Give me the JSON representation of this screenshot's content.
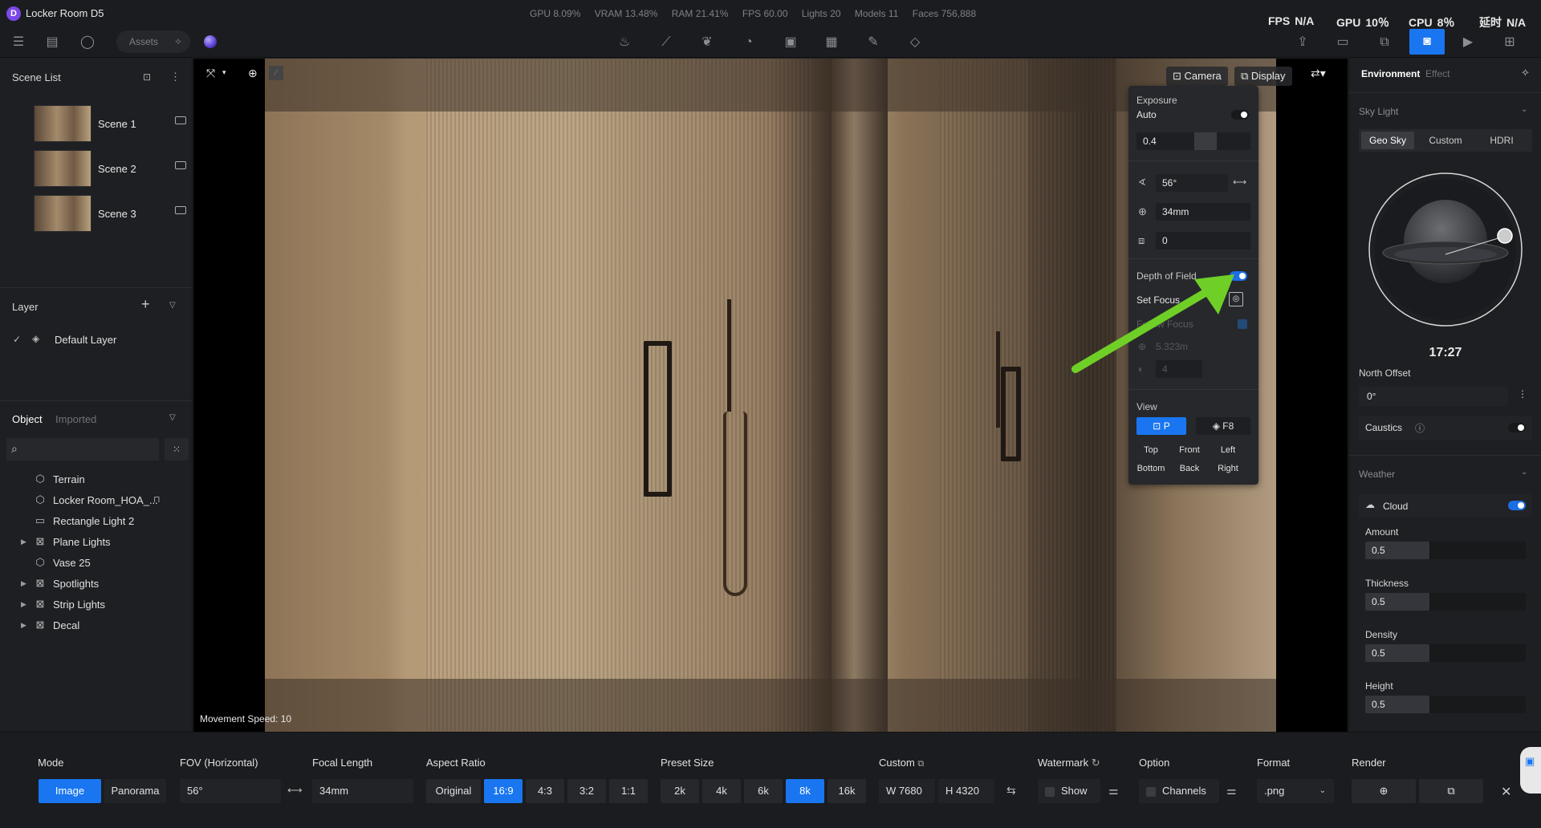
{
  "app": {
    "logo": "D",
    "title": "Locker Room D5"
  },
  "stats": {
    "gpu": "GPU 8.09%",
    "vram": "VRAM 13.48%",
    "ram": "RAM 21.41%",
    "fps": "FPS 60.00",
    "lights": "Lights 20",
    "models": "Models 11",
    "faces": "Faces 756,888"
  },
  "perf": {
    "fps_label": "FPS",
    "fps_val": "N/A",
    "gpu_label": "GPU",
    "gpu_val": "10％",
    "cpu_label": "CPU",
    "cpu_val": "8％",
    "delay_label": "延时",
    "delay_val": "N/A"
  },
  "toolbar": {
    "assets": "Assets"
  },
  "scene_list": {
    "title": "Scene List",
    "items": [
      {
        "label": "Scene 1"
      },
      {
        "label": "Scene 2"
      },
      {
        "label": "Scene 3"
      }
    ]
  },
  "layer": {
    "title": "Layer",
    "default": "Default Layer"
  },
  "objects": {
    "tab_object": "Object",
    "tab_imported": "Imported",
    "items": [
      {
        "label": "Terrain",
        "expandable": false
      },
      {
        "label": "Locker Room_HOA_...",
        "expandable": false
      },
      {
        "label": "Rectangle Light 2",
        "expandable": false
      },
      {
        "label": "Plane Lights",
        "expandable": true
      },
      {
        "label": "Vase 25",
        "expandable": false
      },
      {
        "label": "Spotlights",
        "expandable": true
      },
      {
        "label": "Strip Lights",
        "expandable": true
      },
      {
        "label": "Decal",
        "expandable": false
      }
    ]
  },
  "viewport": {
    "camera_btn": "Camera",
    "display_btn": "Display",
    "movement_speed": "Movement Speed: 10"
  },
  "camera_panel": {
    "exposure": "Exposure",
    "auto": "Auto",
    "exposure_val": "0.4",
    "fov": "56°",
    "focal": "34mm",
    "roll": "0",
    "dof": "Depth of Field",
    "set_focus": "Set Focus",
    "follow_focus": "Follow Focus",
    "focus_dist": "5.323m",
    "aperture": "4",
    "view": "View",
    "view_p": "P",
    "view_f8": "F8",
    "views": [
      "Top",
      "Front",
      "Left",
      "Bottom",
      "Back",
      "Right"
    ]
  },
  "right_panel": {
    "tab_env": "Environment",
    "tab_effect": "Effect",
    "sky_light": "Sky Light",
    "sky_tabs": [
      "Geo Sky",
      "Custom",
      "HDRI"
    ],
    "time": "17:27",
    "north_offset": "North Offset",
    "north_val": "0°",
    "caustics": "Caustics",
    "weather": "Weather",
    "cloud": "Cloud",
    "sliders": [
      {
        "label": "Amount",
        "value": "0.5"
      },
      {
        "label": "Thickness",
        "value": "0.5"
      },
      {
        "label": "Density",
        "value": "0.5"
      },
      {
        "label": "Height",
        "value": "0.5"
      }
    ]
  },
  "bottom": {
    "mode": "Mode",
    "mode_image": "Image",
    "mode_panorama": "Panorama",
    "fov": "FOV (Horizontal)",
    "fov_val": "56°",
    "focal": "Focal Length",
    "focal_val": "34mm",
    "aspect": "Aspect Ratio",
    "aspects": [
      "Original",
      "16:9",
      "4:3",
      "3:2",
      "1:1"
    ],
    "preset": "Preset Size",
    "presets": [
      "2k",
      "4k",
      "6k",
      "8k",
      "16k"
    ],
    "custom": "Custom",
    "w": "W  7680",
    "h": "H  4320",
    "watermark": "Watermark",
    "show": "Show",
    "option": "Option",
    "channels": "Channels",
    "format": "Format",
    "format_val": ".png",
    "render": "Render"
  },
  "colors": {
    "accent": "#1976f0",
    "arrow": "#6fcf26"
  }
}
